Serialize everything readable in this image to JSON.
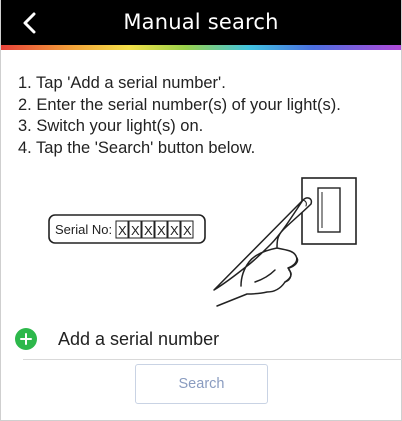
{
  "header": {
    "title": "Manual search",
    "back_icon": "chevron-left-icon"
  },
  "instructions": [
    "1. Tap 'Add a serial number'.",
    "2. Enter the serial number(s) of your light(s).",
    "3. Switch your light(s) on.",
    "4. Tap the 'Search' button below."
  ],
  "illustration": {
    "serial_label": "Serial No:",
    "serial_chars": [
      "X",
      "X",
      "X",
      "X",
      "X",
      "X"
    ]
  },
  "add_serial": {
    "label": "Add a serial number",
    "icon": "plus-circle-icon",
    "icon_color": "#2db84b"
  },
  "search_button": {
    "label": "Search",
    "state": "disabled"
  },
  "colors": {
    "header_bg": "#000000",
    "accent_green": "#2db84b",
    "button_text": "#8a9cc0",
    "button_border": "#c9d3e4"
  }
}
